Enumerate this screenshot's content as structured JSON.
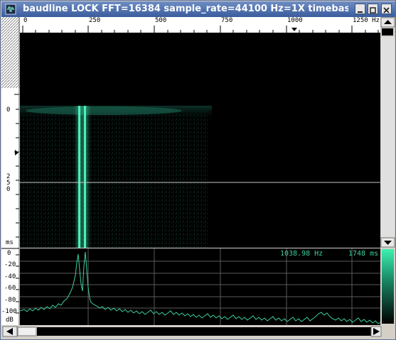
{
  "window": {
    "title": "baudline  LOCK FFT=16384 sample_rate=44100 Hz=1X timebase=36X  bau"
  },
  "freq_ruler": {
    "labels": [
      "0",
      "250",
      "500",
      "750",
      "1000",
      "1250 Hz"
    ]
  },
  "time_axis": {
    "labels": [
      "0",
      "2",
      "5",
      "0",
      "0",
      "ms"
    ]
  },
  "spectrum": {
    "readout_freq": "1038.98 Hz",
    "readout_time": "1748 ms",
    "db_labels": [
      "0",
      "-20",
      "-40",
      "-60",
      "-80",
      "-100",
      "dB"
    ]
  },
  "colors": {
    "trace": "#3cd0a0",
    "title_bar": "#4a6cac",
    "background": "#000000"
  }
}
